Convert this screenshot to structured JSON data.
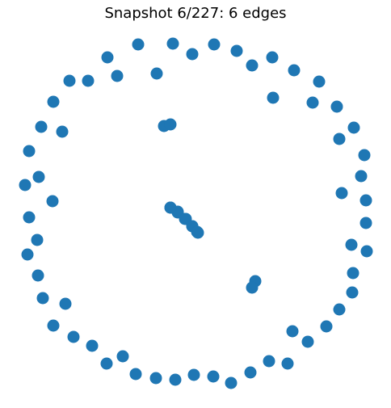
{
  "title": "Snapshot 6/227: 6 edges",
  "colors": {
    "node": "#1f77b4",
    "edge": "#1f77b4",
    "background": "#ffffff"
  },
  "graph": {
    "node_count": 73,
    "edge_count": 6
  }
}
